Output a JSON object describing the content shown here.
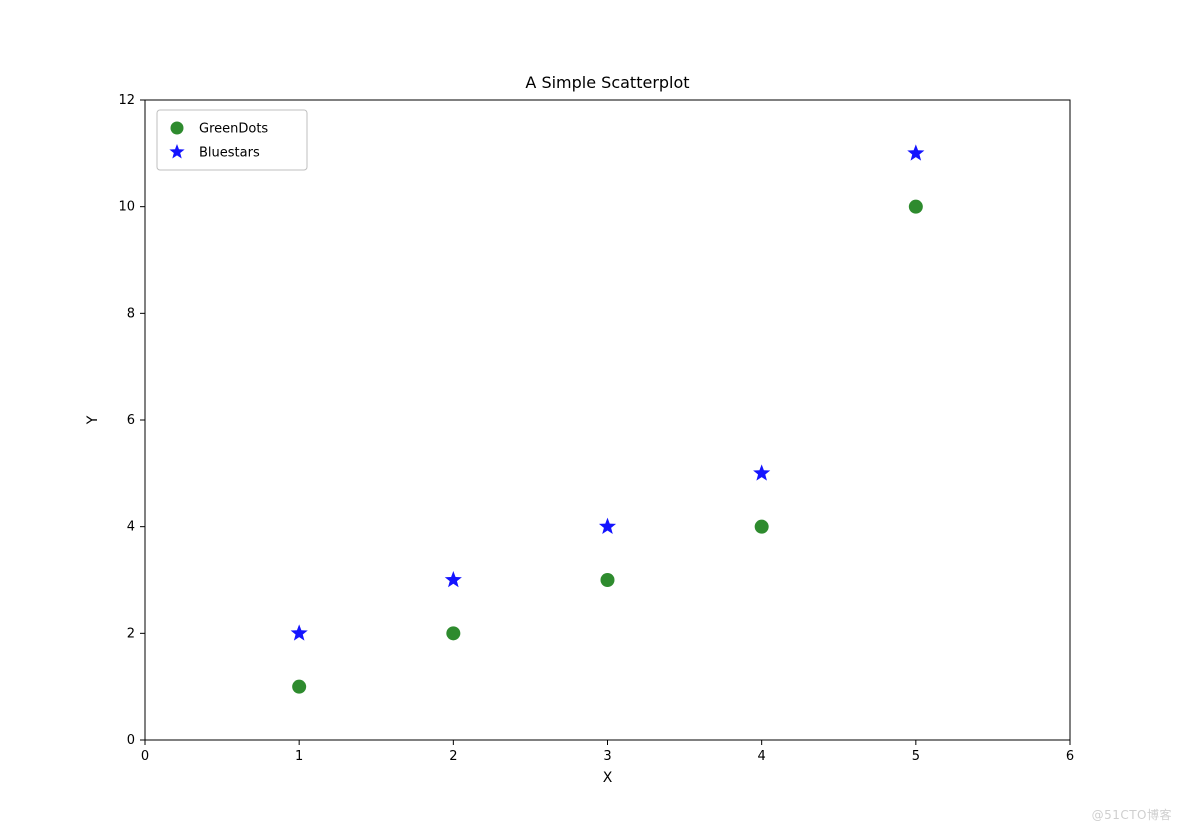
{
  "chart_data": {
    "type": "scatter",
    "title": "A Simple Scatterplot",
    "xlabel": "X",
    "ylabel": "Y",
    "xlim": [
      0,
      6
    ],
    "ylim": [
      0,
      12
    ],
    "xticks": [
      0,
      1,
      2,
      3,
      4,
      5,
      6
    ],
    "yticks": [
      0,
      2,
      4,
      6,
      8,
      10,
      12
    ],
    "series": [
      {
        "name": "GreenDots",
        "marker": "circle",
        "color": "#2e8b2e",
        "x": [
          1,
          2,
          3,
          4,
          5
        ],
        "y": [
          1,
          2,
          3,
          4,
          10
        ]
      },
      {
        "name": "Bluestars",
        "marker": "star",
        "color": "#1414ff",
        "x": [
          1,
          2,
          3,
          4,
          5
        ],
        "y": [
          2,
          3,
          4,
          5,
          11
        ]
      }
    ],
    "legend_position": "upper-left"
  },
  "watermark": "@51CTO博客"
}
